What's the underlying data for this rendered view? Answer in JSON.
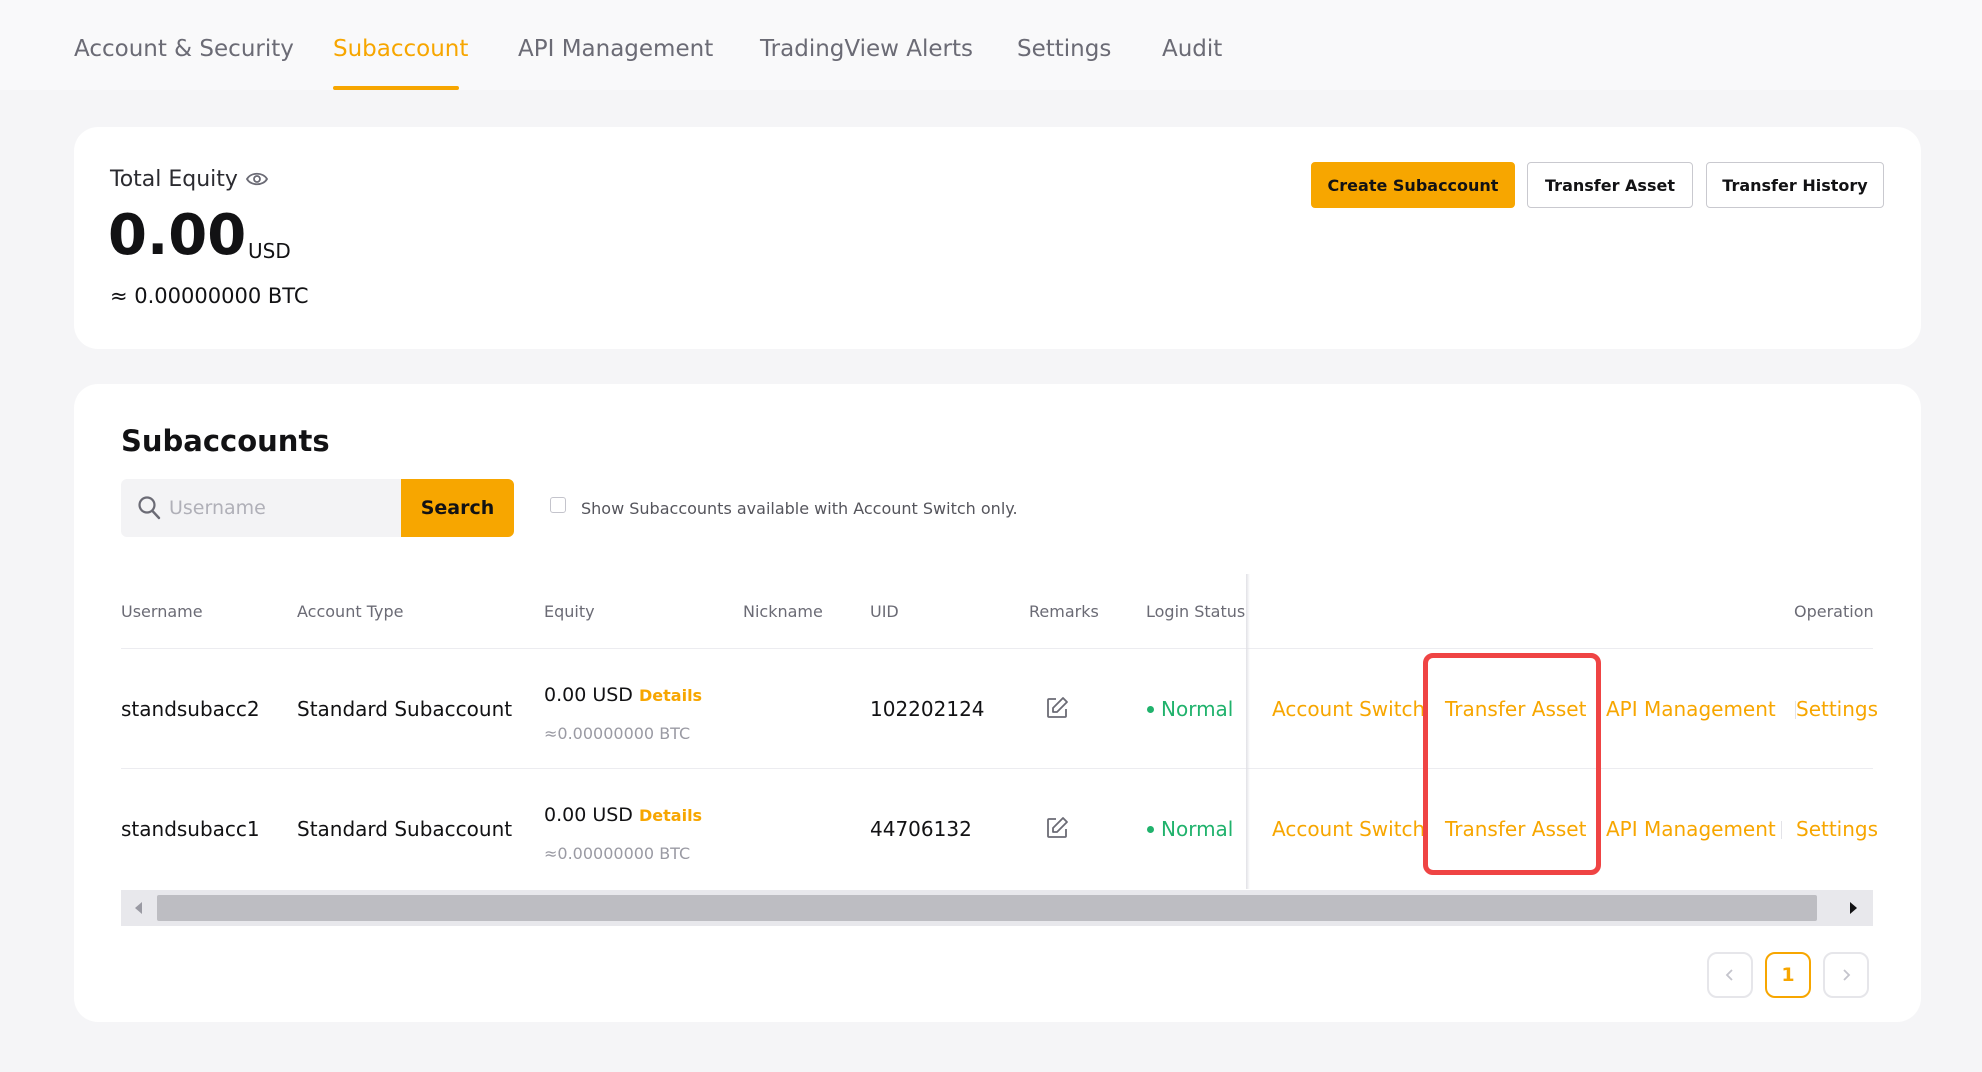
{
  "nav": {
    "tabs": [
      {
        "label": "Account & Security"
      },
      {
        "label": "Subaccount"
      },
      {
        "label": "API Management"
      },
      {
        "label": "TradingView Alerts"
      },
      {
        "label": "Settings"
      },
      {
        "label": "Audit"
      }
    ],
    "active_tab": "Subaccount"
  },
  "equity": {
    "label": "Total Equity",
    "value": "0.00",
    "unit": "USD",
    "btc": "≈ 0.00000000 BTC"
  },
  "actions": {
    "create": "Create Subaccount",
    "transfer": "Transfer Asset",
    "history": "Transfer History"
  },
  "subaccounts": {
    "title": "Subaccounts",
    "search_placeholder": "Username",
    "search_button": "Search",
    "filter_label": "Show Subaccounts available with Account Switch only.",
    "columns": {
      "username": "Username",
      "account_type": "Account Type",
      "equity": "Equity",
      "nickname": "Nickname",
      "uid": "UID",
      "remarks": "Remarks",
      "login_status": "Login Status",
      "operation": "Operation"
    },
    "rows": [
      {
        "username": "standsubacc2",
        "account_type": "Standard Subaccount",
        "equity": "0.00 USD",
        "details": "Details",
        "equity_btc": "≈0.00000000 BTC",
        "nickname": "",
        "uid": "102202124",
        "status": "Normal",
        "ops": [
          "Account Switch",
          "Transfer Asset",
          "API Management",
          "Settings"
        ]
      },
      {
        "username": "standsubacc1",
        "account_type": "Standard Subaccount",
        "equity": "0.00 USD",
        "details": "Details",
        "equity_btc": "≈0.00000000 BTC",
        "nickname": "",
        "uid": "44706132",
        "status": "Normal",
        "ops": [
          "Account Switch",
          "Transfer Asset",
          "API Management",
          "Settings"
        ]
      }
    ]
  },
  "pagination": {
    "current": "1"
  },
  "colors": {
    "accent": "#f7a600",
    "status_normal": "#20b26c",
    "highlight": "#ef4444"
  }
}
